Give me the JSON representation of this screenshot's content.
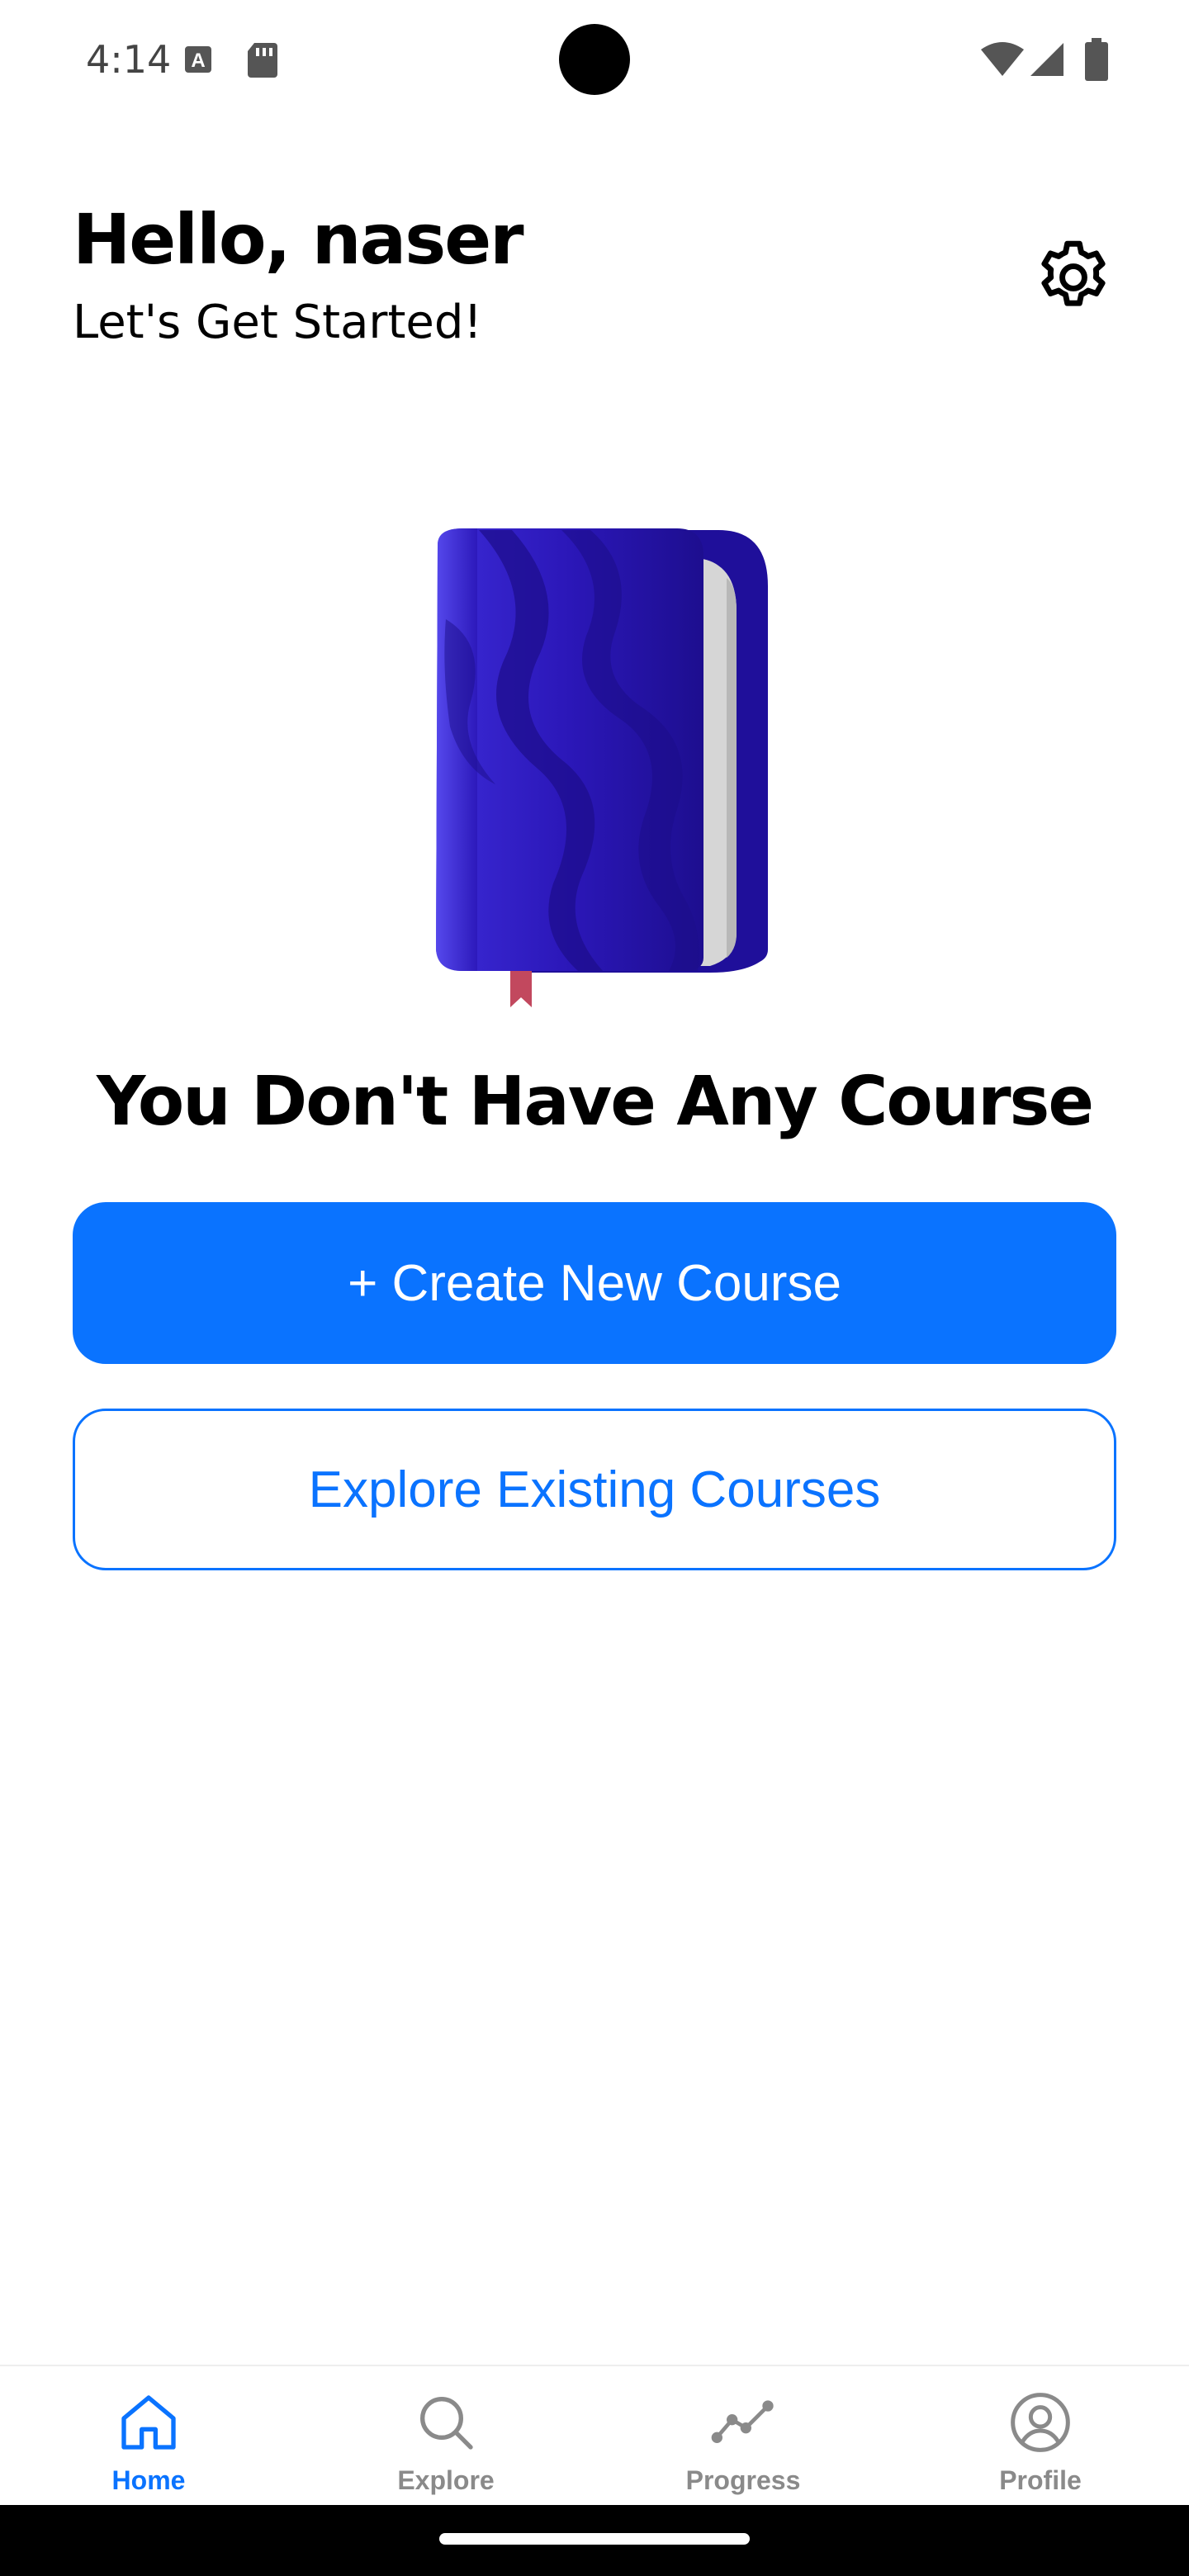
{
  "status_bar": {
    "time": "4:14",
    "icons_left": [
      "font-a-icon",
      "sd-card-icon"
    ],
    "icons_right": [
      "wifi-icon",
      "cell-signal-icon",
      "battery-icon"
    ]
  },
  "header": {
    "title": "Hello, naser",
    "subtitle": "Let's Get Started!",
    "settings_icon": "gear-icon"
  },
  "empty_state": {
    "illustration": "book-icon",
    "title": "You Don't Have Any Course"
  },
  "actions": {
    "create_label": "+ Create New Course",
    "explore_label": "Explore Existing Courses"
  },
  "bottom_nav": {
    "items": [
      {
        "label": "Home",
        "icon": "home-icon",
        "active": true
      },
      {
        "label": "Explore",
        "icon": "search-icon",
        "active": false
      },
      {
        "label": "Progress",
        "icon": "progress-icon",
        "active": false
      },
      {
        "label": "Profile",
        "icon": "profile-icon",
        "active": false
      }
    ]
  },
  "colors": {
    "accent": "#0a73ff",
    "inactive": "#8a8a8a",
    "book_blue": "#2b17b8"
  }
}
